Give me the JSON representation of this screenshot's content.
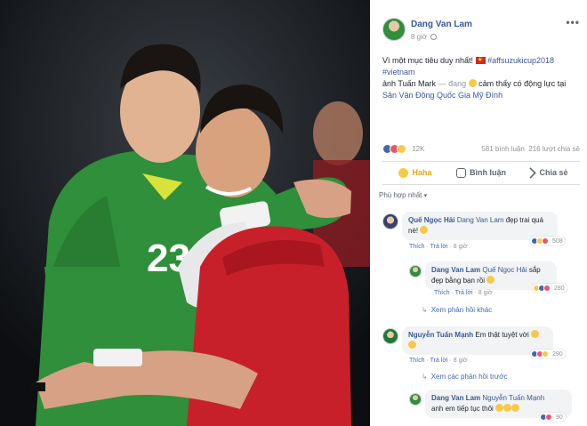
{
  "post": {
    "author": "Dang Van Lam",
    "time": "8 giờ",
    "more_label": "•••",
    "text_line1_prefix": "Vì một mục tiêu duy nhất!",
    "text_hashtag1": "#affsuzukicup2018",
    "text_hashtag2": "#vietnam",
    "text_line2_prefix": "ảnh Tuấn Mark",
    "text_line2_mid": "— đang",
    "text_line2_suffix": "cảm thấy có động lực tại",
    "text_location": "Sân Vận Động Quốc Gia Mỹ Đình"
  },
  "reactions": {
    "count": "12K",
    "comments": "581 bình luận",
    "shares": "216 lượt chia sẻ"
  },
  "actions": {
    "haha": "Haha",
    "comment": "Bình luận",
    "share": "Chia sẻ"
  },
  "sort_label": "Phù hợp nhất",
  "comments": [
    {
      "name": "Quế Ngọc Hải",
      "tag": "Dang Van Lam",
      "text": "đẹp trai quá",
      "text2": "nè!",
      "like": "Thích",
      "reply": "Trả lời",
      "time": "8 giờ",
      "count": "508",
      "replies": [
        {
          "name": "Dang Van Lam",
          "tag": "Quế Ngọc Hải",
          "text": "sắp",
          "text2": "đẹp bằng bạn rồi",
          "like": "Thích",
          "reply": "Trả lời",
          "time": "8 giờ",
          "count": "280"
        }
      ],
      "more_replies": "Xem phản hồi khác"
    },
    {
      "name": "Nguyễn Tuấn Mạnh",
      "text": "Em thật tuyệt vời",
      "like": "Thích",
      "reply": "Trả lời",
      "time": "8 giờ",
      "count": "290",
      "more_replies": "Xem các phản hồi trước",
      "replies": [
        {
          "name": "Dang Van Lam",
          "tag": "Nguyễn Tuấn Mạnh",
          "text": "anh em tiếp tục thôi",
          "count": "90"
        }
      ]
    }
  ],
  "photo": {
    "jersey_number": "23"
  },
  "colors": {
    "link": "#365899",
    "haha": "#e9a908",
    "goalkeeper_jersey": "#2f8f3a",
    "player_jersey": "#c8202a"
  }
}
